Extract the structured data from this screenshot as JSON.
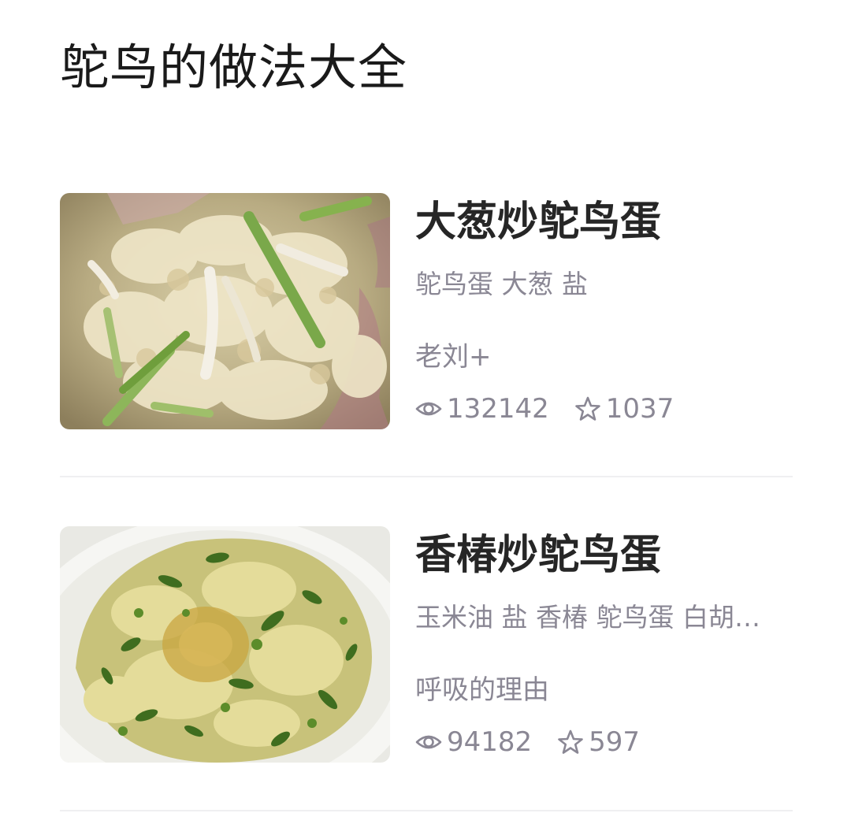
{
  "page": {
    "title": "鸵鸟的做法大全"
  },
  "recipes": [
    {
      "name": "大葱炒鸵鸟蛋",
      "ingredients": "鸵鸟蛋 大葱 盐",
      "author": "老刘+",
      "views": "132142",
      "favorites": "1037",
      "image": "scallion-stir-fried-ostrich-egg-photo"
    },
    {
      "name": "香椿炒鸵鸟蛋",
      "ingredients": "玉米油 盐 香椿 鸵鸟蛋 白胡…",
      "author": "呼吸的理由",
      "views": "94182",
      "favorites": "597",
      "image": "toona-sinensis-stir-fried-ostrich-egg-photo"
    }
  ],
  "icons": {
    "views": "eye-icon",
    "favorites": "star-outline-icon"
  },
  "colors": {
    "title": "#1a1a1a",
    "recipe_name": "#262626",
    "meta_text": "#8a8794",
    "divider": "#efeff1"
  }
}
